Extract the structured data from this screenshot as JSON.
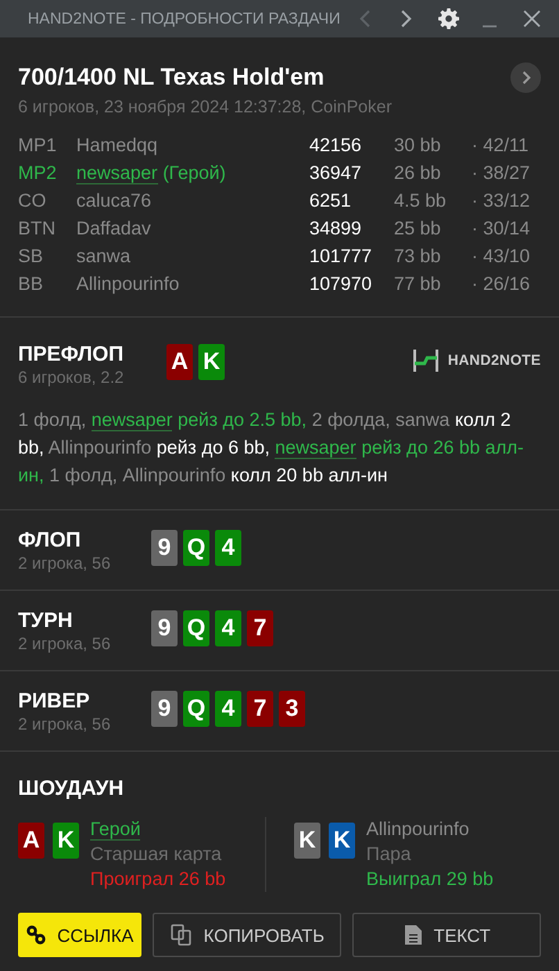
{
  "window": {
    "title": "HAND2NOTE - ПОДРОБНОСТИ РАЗДАЧИ",
    "prev_disabled": true
  },
  "header": {
    "title": "700/1400 NL Texas Hold'em",
    "subtitle": "6 игроков, 23 ноября 2024 12:37:28, CoinPoker"
  },
  "players": [
    {
      "position": "MP1",
      "name": "Hamedqq",
      "hero": false,
      "stack": "42156",
      "bb": "30 bb",
      "stats": "· 42/11"
    },
    {
      "position": "MP2",
      "name": "newsaper",
      "hero": true,
      "hero_tag": "(Герой)",
      "stack": "36947",
      "bb": "26 bb",
      "stats": "· 38/27"
    },
    {
      "position": "CO",
      "name": "caluca76",
      "hero": false,
      "stack": "6251",
      "bb": "4.5 bb",
      "stats": "· 33/12"
    },
    {
      "position": "BTN",
      "name": "Daffadav",
      "hero": false,
      "stack": "34899",
      "bb": "25 bb",
      "stats": "· 30/14"
    },
    {
      "position": "SB",
      "name": "sanwa",
      "hero": false,
      "stack": "101777",
      "bb": "73 bb",
      "stats": "· 43/10"
    },
    {
      "position": "BB",
      "name": "Allinpourinfo",
      "hero": false,
      "stack": "107970",
      "bb": "77 bb",
      "stats": "· 26/16"
    }
  ],
  "streets": [
    {
      "title": "ПРЕФЛОП",
      "subtitle": "6 игроков, 2.2",
      "logo": "HAND2NOTE",
      "cards": [
        {
          "rank": "A",
          "color": "#8b0000"
        },
        {
          "rank": "K",
          "color": "#0a8a0a"
        }
      ],
      "actions": [
        {
          "kind": "muted",
          "text": "1 фолд, "
        },
        {
          "kind": "hero-link",
          "text": "newsaper"
        },
        {
          "kind": "hero",
          "text": " рейз до 2.5 bb,"
        },
        {
          "kind": "muted",
          "text": " 2 фолда, sanwa "
        },
        {
          "kind": "bold",
          "text": "колл 2 bb,"
        },
        {
          "kind": "muted",
          "text": " Allinpourinfo "
        },
        {
          "kind": "bold",
          "text": "рейз до 6 bb, "
        },
        {
          "kind": "hero-link",
          "text": "newsaper"
        },
        {
          "kind": "hero",
          "text": " рейз до 26 bb алл-ин,"
        },
        {
          "kind": "muted",
          "text": " 1 фолд, Allinpourinfo "
        },
        {
          "kind": "bold",
          "text": "колл 20 bb алл-ин"
        }
      ]
    },
    {
      "title": "ФЛОП",
      "subtitle": "2 игрока, 56",
      "cards": [
        {
          "rank": "9",
          "color": "#666666"
        },
        {
          "rank": "Q",
          "color": "#0a8a0a"
        },
        {
          "rank": "4",
          "color": "#0a8a0a"
        }
      ]
    },
    {
      "title": "ТУРН",
      "subtitle": "2 игрока, 56",
      "cards": [
        {
          "rank": "9",
          "color": "#666666"
        },
        {
          "rank": "Q",
          "color": "#0a8a0a"
        },
        {
          "rank": "4",
          "color": "#0a8a0a"
        },
        {
          "rank": "7",
          "color": "#8b0000"
        }
      ]
    },
    {
      "title": "РИВЕР",
      "subtitle": "2 игрока, 56",
      "cards": [
        {
          "rank": "9",
          "color": "#666666"
        },
        {
          "rank": "Q",
          "color": "#0a8a0a"
        },
        {
          "rank": "4",
          "color": "#0a8a0a"
        },
        {
          "rank": "7",
          "color": "#8b0000"
        },
        {
          "rank": "3",
          "color": "#8b0000"
        }
      ]
    }
  ],
  "showdown": {
    "title": "ШОУДАУН",
    "hands": [
      {
        "name": "Герой",
        "hero": true,
        "cards": [
          {
            "rank": "A",
            "color": "#8b0000"
          },
          {
            "rank": "K",
            "color": "#0a8a0a"
          }
        ],
        "combo": "Старшая карта",
        "result": "Проиграл 26 bb",
        "won": false
      },
      {
        "name": "Allinpourinfo",
        "hero": false,
        "cards": [
          {
            "rank": "K",
            "color": "#666666"
          },
          {
            "rank": "K",
            "color": "#0a5bab"
          }
        ],
        "combo": "Пара",
        "result": "Выиграл 29 bb",
        "won": true
      }
    ]
  },
  "buttons": [
    {
      "kind": "link",
      "label": "ССЫЛКА",
      "primary": true
    },
    {
      "kind": "copy",
      "label": "КОПИРОВАТЬ",
      "primary": false
    },
    {
      "kind": "text",
      "label": "ТЕКСТ",
      "primary": false
    }
  ]
}
